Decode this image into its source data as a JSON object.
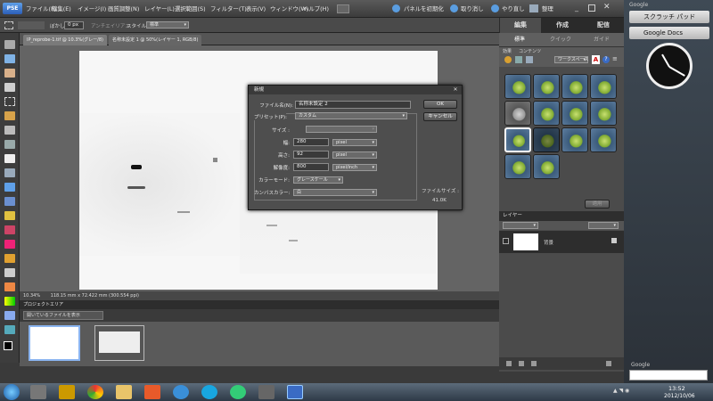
{
  "menubar": {
    "logo": "PSE",
    "items": [
      "ファイル(F)",
      "編集(E)",
      "イメージ(I)",
      "画質調整(N)",
      "レイヤー(L)",
      "選択範囲(S)",
      "フィルター(T)",
      "表示(V)",
      "ウィンドウ(W)",
      "ヘルプ(H)"
    ],
    "panel_reset": "パネルを初期化",
    "undo": "取り消し",
    "redo": "やり直し",
    "organize": "整理"
  },
  "optbar": {
    "blur_label": "ぼかし :",
    "blur_value": "0 px",
    "antialias": "アンチエイリアス",
    "style_label": "スタイル :",
    "style_value": "標準"
  },
  "right_tabs": [
    "編集",
    "作成",
    "配信"
  ],
  "sub_tabs": [
    "標準",
    "クイック",
    "ガイド"
  ],
  "effects_tabs": [
    "効果",
    "コンテンツ"
  ],
  "effects_select": "ワークスペース",
  "apply_label": "適用",
  "layers_title": "レイヤー",
  "layer_name": "背景",
  "doc_tabs": [
    "IP_reprobe-1.tif @ 10.3%(グレー/8)",
    "名称未設定 1 @ 50%(レイヤー 1, RGB/8)"
  ],
  "status": {
    "zoom": "10.34%",
    "info": "118.15 mm x 72.422 mm (300.554 ppi)"
  },
  "project": {
    "title": "プロジェクトエリア",
    "select": "開いているファイルを表示"
  },
  "dialog": {
    "title": "新規",
    "name_label": "ファイル名(N):",
    "name_value": "名称未設定 2",
    "preset_label": "プリセット(P):",
    "preset_value": "カスタム",
    "size_label": "サイズ :",
    "size_value": "",
    "width_label": "幅:",
    "width_value": "280",
    "width_unit": "pixel",
    "height_label": "高さ:",
    "height_value": "92",
    "height_unit": "pixel",
    "res_label": "解像度:",
    "res_value": "800",
    "res_unit": "pixel/inch",
    "color_label": "カラーモード:",
    "color_value": "グレースケール",
    "bg_label": "カンバスカラー:",
    "bg_value": "白",
    "ok": "OK",
    "cancel": "キャンセル",
    "filesize_label": "ファイルサイズ :",
    "filesize_value": "41.0K"
  },
  "sidebar": {
    "brand": "Google",
    "gadget1": "スクラッチ パッド",
    "gadget2": "Google Docs",
    "search_brand": "Google"
  },
  "taskbar": {
    "time": "13:52",
    "date": "2012/10/06"
  },
  "colors": {
    "accent": "#2c5fb8",
    "dialog": "#4e4e4e",
    "panel": "#4b4b4b"
  }
}
